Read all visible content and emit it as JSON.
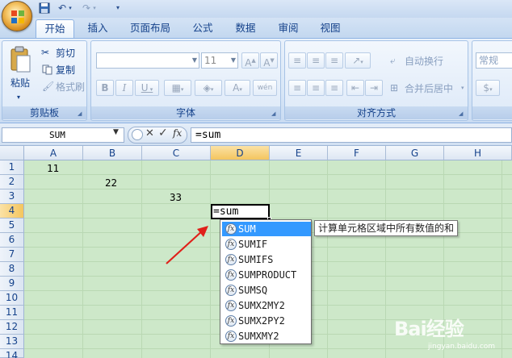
{
  "ribbon": {
    "tabs": [
      "开始",
      "插入",
      "页面布局",
      "公式",
      "数据",
      "审阅",
      "视图"
    ],
    "clipboard": {
      "paste": "粘贴",
      "cut": "剪切",
      "copy": "复制",
      "format_painter": "格式刷",
      "label": "剪贴板"
    },
    "font": {
      "font_size": "11",
      "bold": "B",
      "italic": "I",
      "underline": "U",
      "label": "字体"
    },
    "alignment": {
      "wrap_text": "自动换行",
      "merge_center": "合并后居中",
      "label": "对齐方式"
    },
    "number": {
      "format": "常规"
    }
  },
  "formula_bar": {
    "name_box": "SUM",
    "fx_label": "fx",
    "formula": "=sum"
  },
  "grid": {
    "columns": [
      "A",
      "B",
      "C",
      "D",
      "E",
      "F",
      "G",
      "H"
    ],
    "rows": [
      "1",
      "2",
      "3",
      "4",
      "5",
      "6",
      "7",
      "8",
      "9",
      "10",
      "11",
      "12",
      "13",
      "14"
    ],
    "cells": {
      "A1": "11",
      "B2": "22",
      "C3": "33"
    },
    "active_cell_text": "=sum"
  },
  "autocomplete": {
    "items": [
      "SUM",
      "SUMIF",
      "SUMIFS",
      "SUMPRODUCT",
      "SUMSQ",
      "SUMX2MY2",
      "SUMX2PY2",
      "SUMXMY2"
    ],
    "selected_index": 0,
    "tooltip": "计算单元格区域中所有数值的和"
  },
  "watermark": {
    "logo": "Bai经验",
    "url": "jingyan.baidu.com"
  },
  "colors": {
    "grid_bg": "#cde8c9",
    "accent": "#15428b",
    "selection": "#3399ff",
    "arrow": "#e0201a"
  }
}
